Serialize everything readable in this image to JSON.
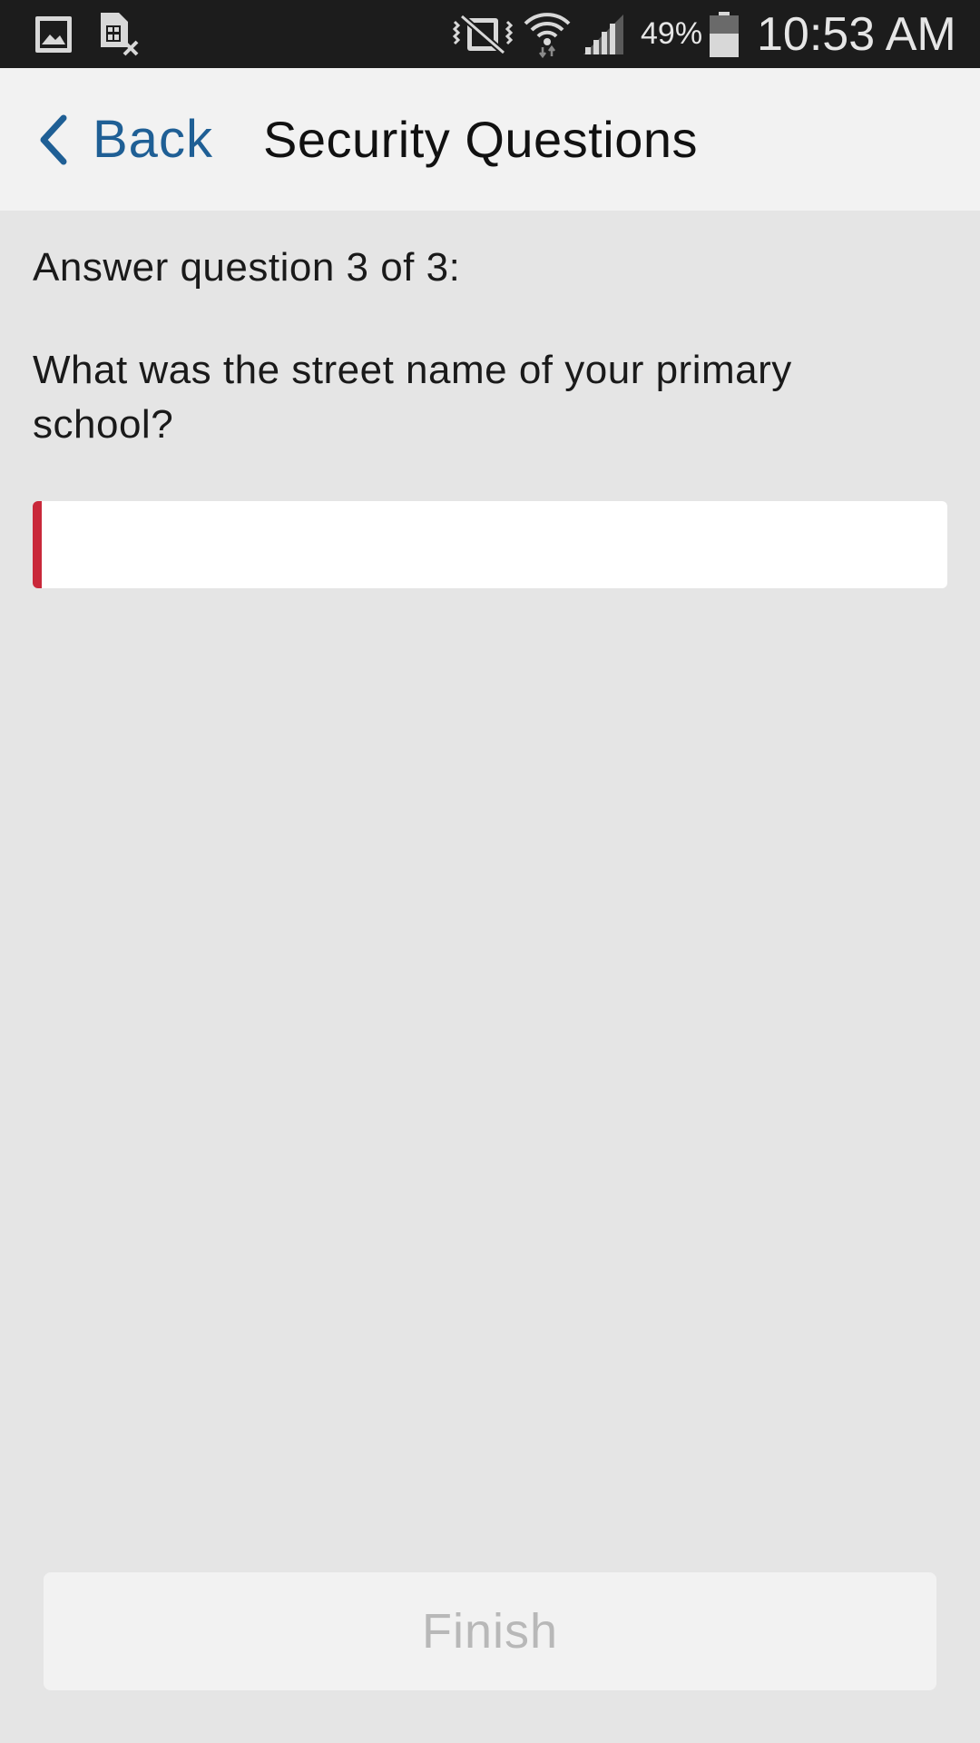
{
  "status_bar": {
    "left_icons": [
      "gallery-icon",
      "sim-card-error-icon"
    ],
    "right_icons": [
      "vibrate-mute-icon",
      "wifi-icon",
      "signal-icon",
      "battery-icon"
    ],
    "battery_percent": "49%",
    "time": "10:53 AM"
  },
  "nav": {
    "back_label": "Back",
    "title": "Security Questions"
  },
  "question": {
    "counter": "Answer question 3 of 3:",
    "text": "What was the street name of your primary school?",
    "answer_value": "",
    "answer_placeholder": ""
  },
  "footer": {
    "finish_label": "Finish"
  },
  "colors": {
    "accent": "#1f5f95",
    "error_border": "#c9283a",
    "background": "#e5e5e5",
    "status_bar": "#1c1c1c"
  }
}
